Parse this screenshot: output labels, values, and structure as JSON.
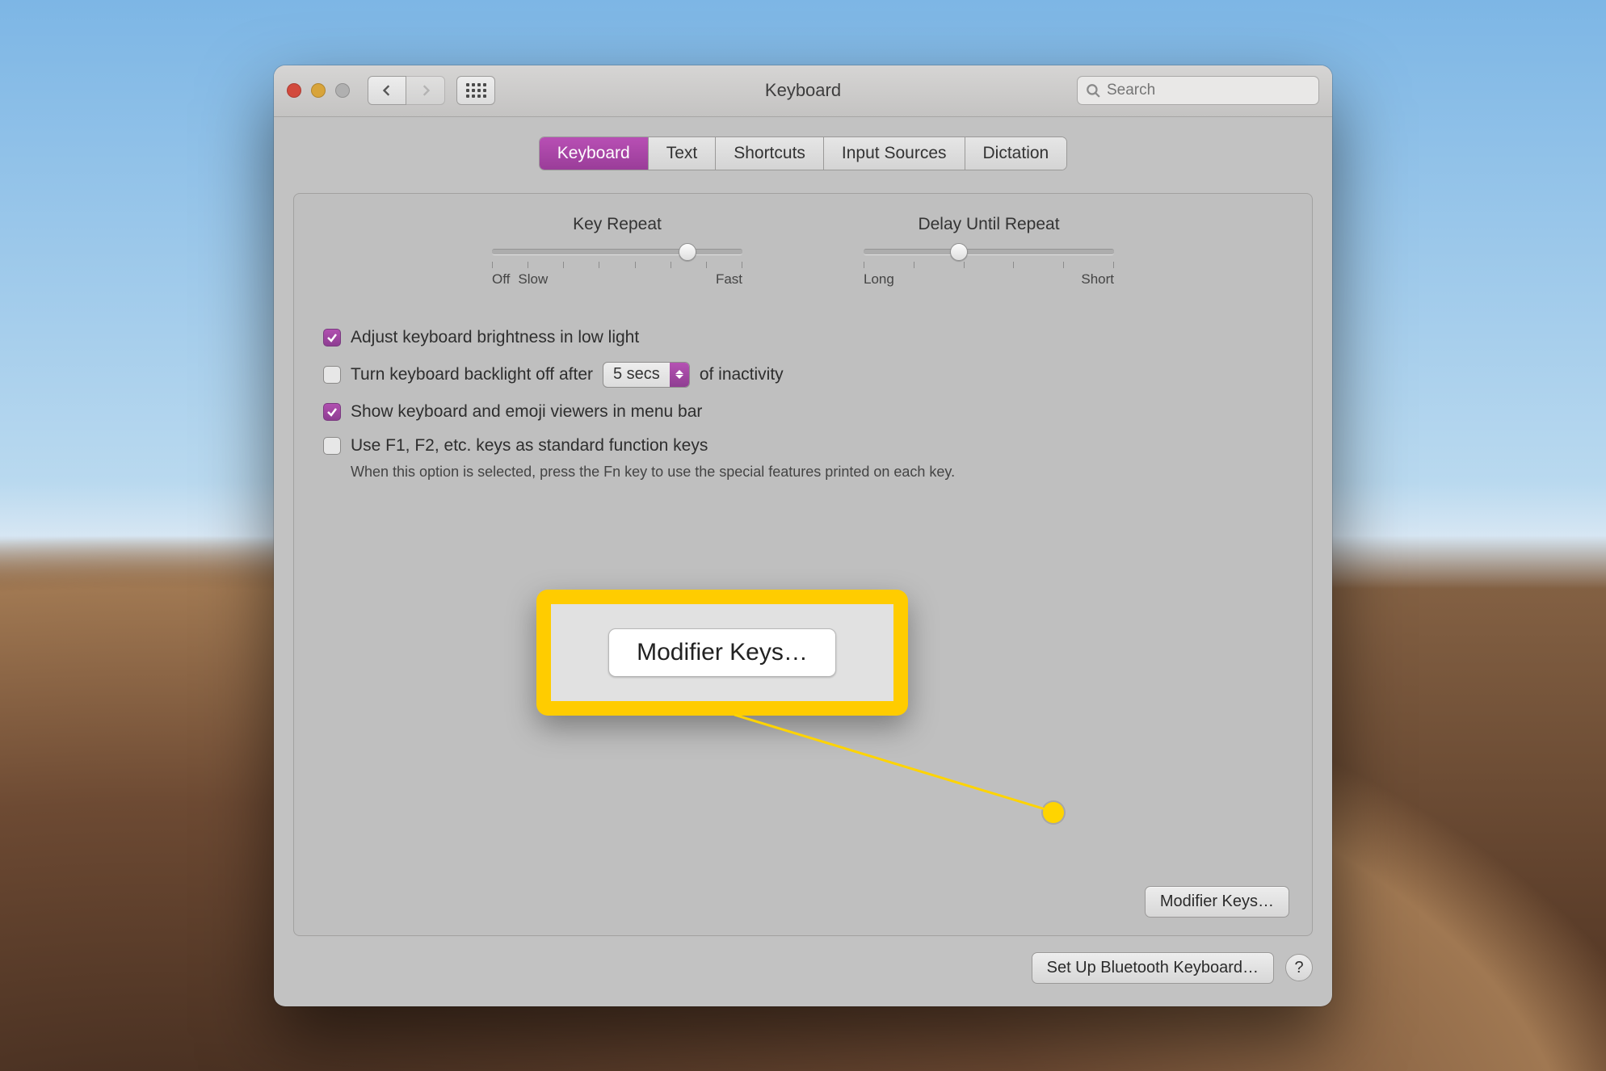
{
  "window": {
    "title": "Keyboard"
  },
  "search": {
    "placeholder": "Search"
  },
  "tabs": [
    {
      "label": "Keyboard",
      "active": true
    },
    {
      "label": "Text"
    },
    {
      "label": "Shortcuts"
    },
    {
      "label": "Input Sources"
    },
    {
      "label": "Dictation"
    }
  ],
  "sliders": {
    "key_repeat": {
      "title": "Key Repeat",
      "left_label": "Off",
      "mid_label": "Slow",
      "right_label": "Fast",
      "tick_count": 8,
      "value_pct": 78
    },
    "delay_repeat": {
      "title": "Delay Until Repeat",
      "left_label": "Long",
      "right_label": "Short",
      "tick_count": 6,
      "value_pct": 38
    }
  },
  "options": {
    "brightness_low_light": {
      "label": "Adjust keyboard brightness in low light",
      "checked": true
    },
    "backlight_off": {
      "prefix": "Turn keyboard backlight off after",
      "select_value": "5 secs",
      "suffix": "of inactivity",
      "checked": false
    },
    "show_viewers": {
      "label": "Show keyboard and emoji viewers in menu bar",
      "checked": true
    },
    "fn_keys": {
      "label": "Use F1, F2, etc. keys as standard function keys",
      "note": "When this option is selected, press the Fn key to use the special features printed on each key.",
      "checked": false
    }
  },
  "buttons": {
    "modifier_keys": "Modifier Keys…",
    "bluetooth": "Set Up Bluetooth Keyboard…",
    "help": "?"
  },
  "callout": {
    "button_label": "Modifier Keys…"
  }
}
